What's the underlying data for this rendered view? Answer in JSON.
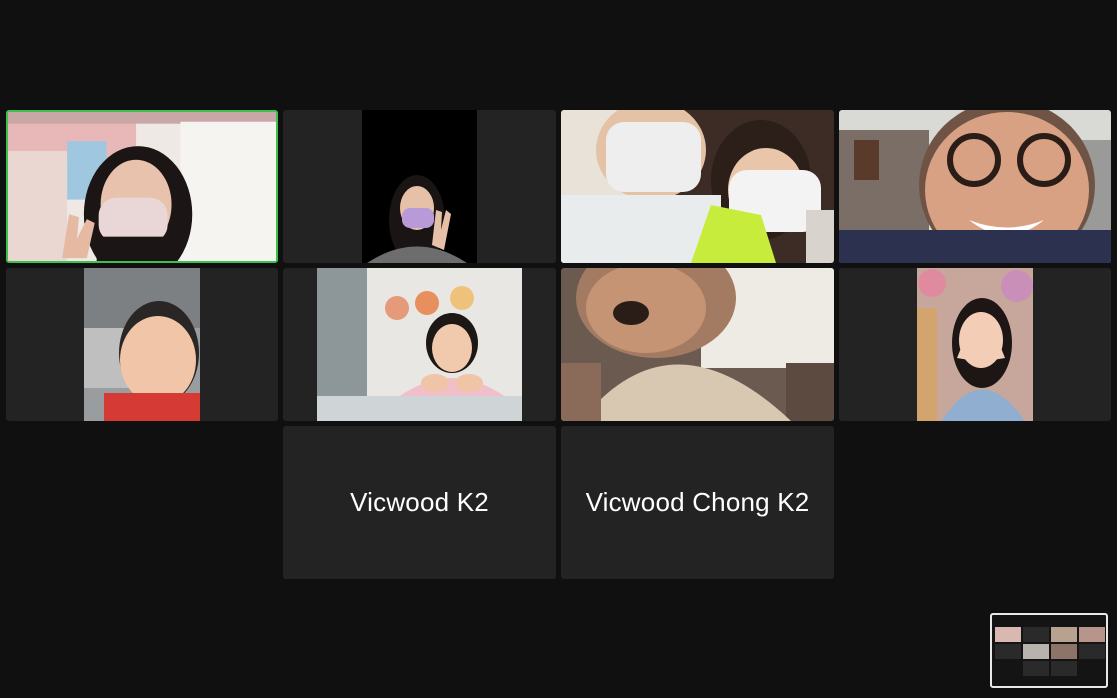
{
  "meeting": {
    "participants": [
      {
        "id": "p1",
        "video_on": true,
        "active_speaker": true
      },
      {
        "id": "p2",
        "video_on": true
      },
      {
        "id": "p3",
        "video_on": true
      },
      {
        "id": "p4",
        "video_on": true
      },
      {
        "id": "p5",
        "video_on": true
      },
      {
        "id": "p6",
        "video_on": true
      },
      {
        "id": "p7",
        "video_on": true
      },
      {
        "id": "p8",
        "video_on": true
      },
      {
        "id": "p9",
        "video_on": false,
        "name": "Vicwood K2"
      },
      {
        "id": "p10",
        "video_on": false,
        "name": "Vicwood Chong K2"
      }
    ]
  },
  "colors": {
    "background": "#101010",
    "tile": "#232323",
    "active_speaker_border": "#3fbf4f",
    "mini_border": "#e9e9e9"
  },
  "icons": {
    "minimap": "gallery-minimap-icon"
  }
}
